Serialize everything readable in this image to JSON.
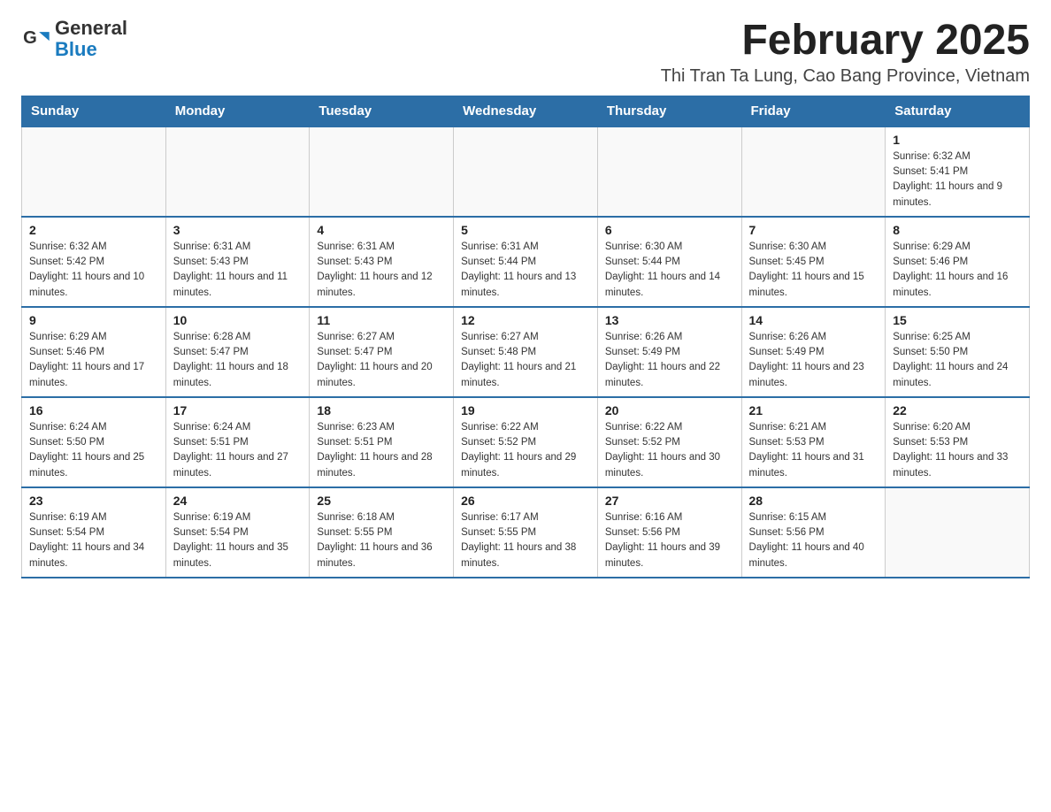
{
  "logo": {
    "text_general": "General",
    "text_blue": "Blue"
  },
  "header": {
    "month_title": "February 2025",
    "location": "Thi Tran Ta Lung, Cao Bang Province, Vietnam"
  },
  "weekdays": [
    "Sunday",
    "Monday",
    "Tuesday",
    "Wednesday",
    "Thursday",
    "Friday",
    "Saturday"
  ],
  "weeks": [
    [
      {
        "day": "",
        "info": ""
      },
      {
        "day": "",
        "info": ""
      },
      {
        "day": "",
        "info": ""
      },
      {
        "day": "",
        "info": ""
      },
      {
        "day": "",
        "info": ""
      },
      {
        "day": "",
        "info": ""
      },
      {
        "day": "1",
        "info": "Sunrise: 6:32 AM\nSunset: 5:41 PM\nDaylight: 11 hours and 9 minutes."
      }
    ],
    [
      {
        "day": "2",
        "info": "Sunrise: 6:32 AM\nSunset: 5:42 PM\nDaylight: 11 hours and 10 minutes."
      },
      {
        "day": "3",
        "info": "Sunrise: 6:31 AM\nSunset: 5:43 PM\nDaylight: 11 hours and 11 minutes."
      },
      {
        "day": "4",
        "info": "Sunrise: 6:31 AM\nSunset: 5:43 PM\nDaylight: 11 hours and 12 minutes."
      },
      {
        "day": "5",
        "info": "Sunrise: 6:31 AM\nSunset: 5:44 PM\nDaylight: 11 hours and 13 minutes."
      },
      {
        "day": "6",
        "info": "Sunrise: 6:30 AM\nSunset: 5:44 PM\nDaylight: 11 hours and 14 minutes."
      },
      {
        "day": "7",
        "info": "Sunrise: 6:30 AM\nSunset: 5:45 PM\nDaylight: 11 hours and 15 minutes."
      },
      {
        "day": "8",
        "info": "Sunrise: 6:29 AM\nSunset: 5:46 PM\nDaylight: 11 hours and 16 minutes."
      }
    ],
    [
      {
        "day": "9",
        "info": "Sunrise: 6:29 AM\nSunset: 5:46 PM\nDaylight: 11 hours and 17 minutes."
      },
      {
        "day": "10",
        "info": "Sunrise: 6:28 AM\nSunset: 5:47 PM\nDaylight: 11 hours and 18 minutes."
      },
      {
        "day": "11",
        "info": "Sunrise: 6:27 AM\nSunset: 5:47 PM\nDaylight: 11 hours and 20 minutes."
      },
      {
        "day": "12",
        "info": "Sunrise: 6:27 AM\nSunset: 5:48 PM\nDaylight: 11 hours and 21 minutes."
      },
      {
        "day": "13",
        "info": "Sunrise: 6:26 AM\nSunset: 5:49 PM\nDaylight: 11 hours and 22 minutes."
      },
      {
        "day": "14",
        "info": "Sunrise: 6:26 AM\nSunset: 5:49 PM\nDaylight: 11 hours and 23 minutes."
      },
      {
        "day": "15",
        "info": "Sunrise: 6:25 AM\nSunset: 5:50 PM\nDaylight: 11 hours and 24 minutes."
      }
    ],
    [
      {
        "day": "16",
        "info": "Sunrise: 6:24 AM\nSunset: 5:50 PM\nDaylight: 11 hours and 25 minutes."
      },
      {
        "day": "17",
        "info": "Sunrise: 6:24 AM\nSunset: 5:51 PM\nDaylight: 11 hours and 27 minutes."
      },
      {
        "day": "18",
        "info": "Sunrise: 6:23 AM\nSunset: 5:51 PM\nDaylight: 11 hours and 28 minutes."
      },
      {
        "day": "19",
        "info": "Sunrise: 6:22 AM\nSunset: 5:52 PM\nDaylight: 11 hours and 29 minutes."
      },
      {
        "day": "20",
        "info": "Sunrise: 6:22 AM\nSunset: 5:52 PM\nDaylight: 11 hours and 30 minutes."
      },
      {
        "day": "21",
        "info": "Sunrise: 6:21 AM\nSunset: 5:53 PM\nDaylight: 11 hours and 31 minutes."
      },
      {
        "day": "22",
        "info": "Sunrise: 6:20 AM\nSunset: 5:53 PM\nDaylight: 11 hours and 33 minutes."
      }
    ],
    [
      {
        "day": "23",
        "info": "Sunrise: 6:19 AM\nSunset: 5:54 PM\nDaylight: 11 hours and 34 minutes."
      },
      {
        "day": "24",
        "info": "Sunrise: 6:19 AM\nSunset: 5:54 PM\nDaylight: 11 hours and 35 minutes."
      },
      {
        "day": "25",
        "info": "Sunrise: 6:18 AM\nSunset: 5:55 PM\nDaylight: 11 hours and 36 minutes."
      },
      {
        "day": "26",
        "info": "Sunrise: 6:17 AM\nSunset: 5:55 PM\nDaylight: 11 hours and 38 minutes."
      },
      {
        "day": "27",
        "info": "Sunrise: 6:16 AM\nSunset: 5:56 PM\nDaylight: 11 hours and 39 minutes."
      },
      {
        "day": "28",
        "info": "Sunrise: 6:15 AM\nSunset: 5:56 PM\nDaylight: 11 hours and 40 minutes."
      },
      {
        "day": "",
        "info": ""
      }
    ]
  ]
}
